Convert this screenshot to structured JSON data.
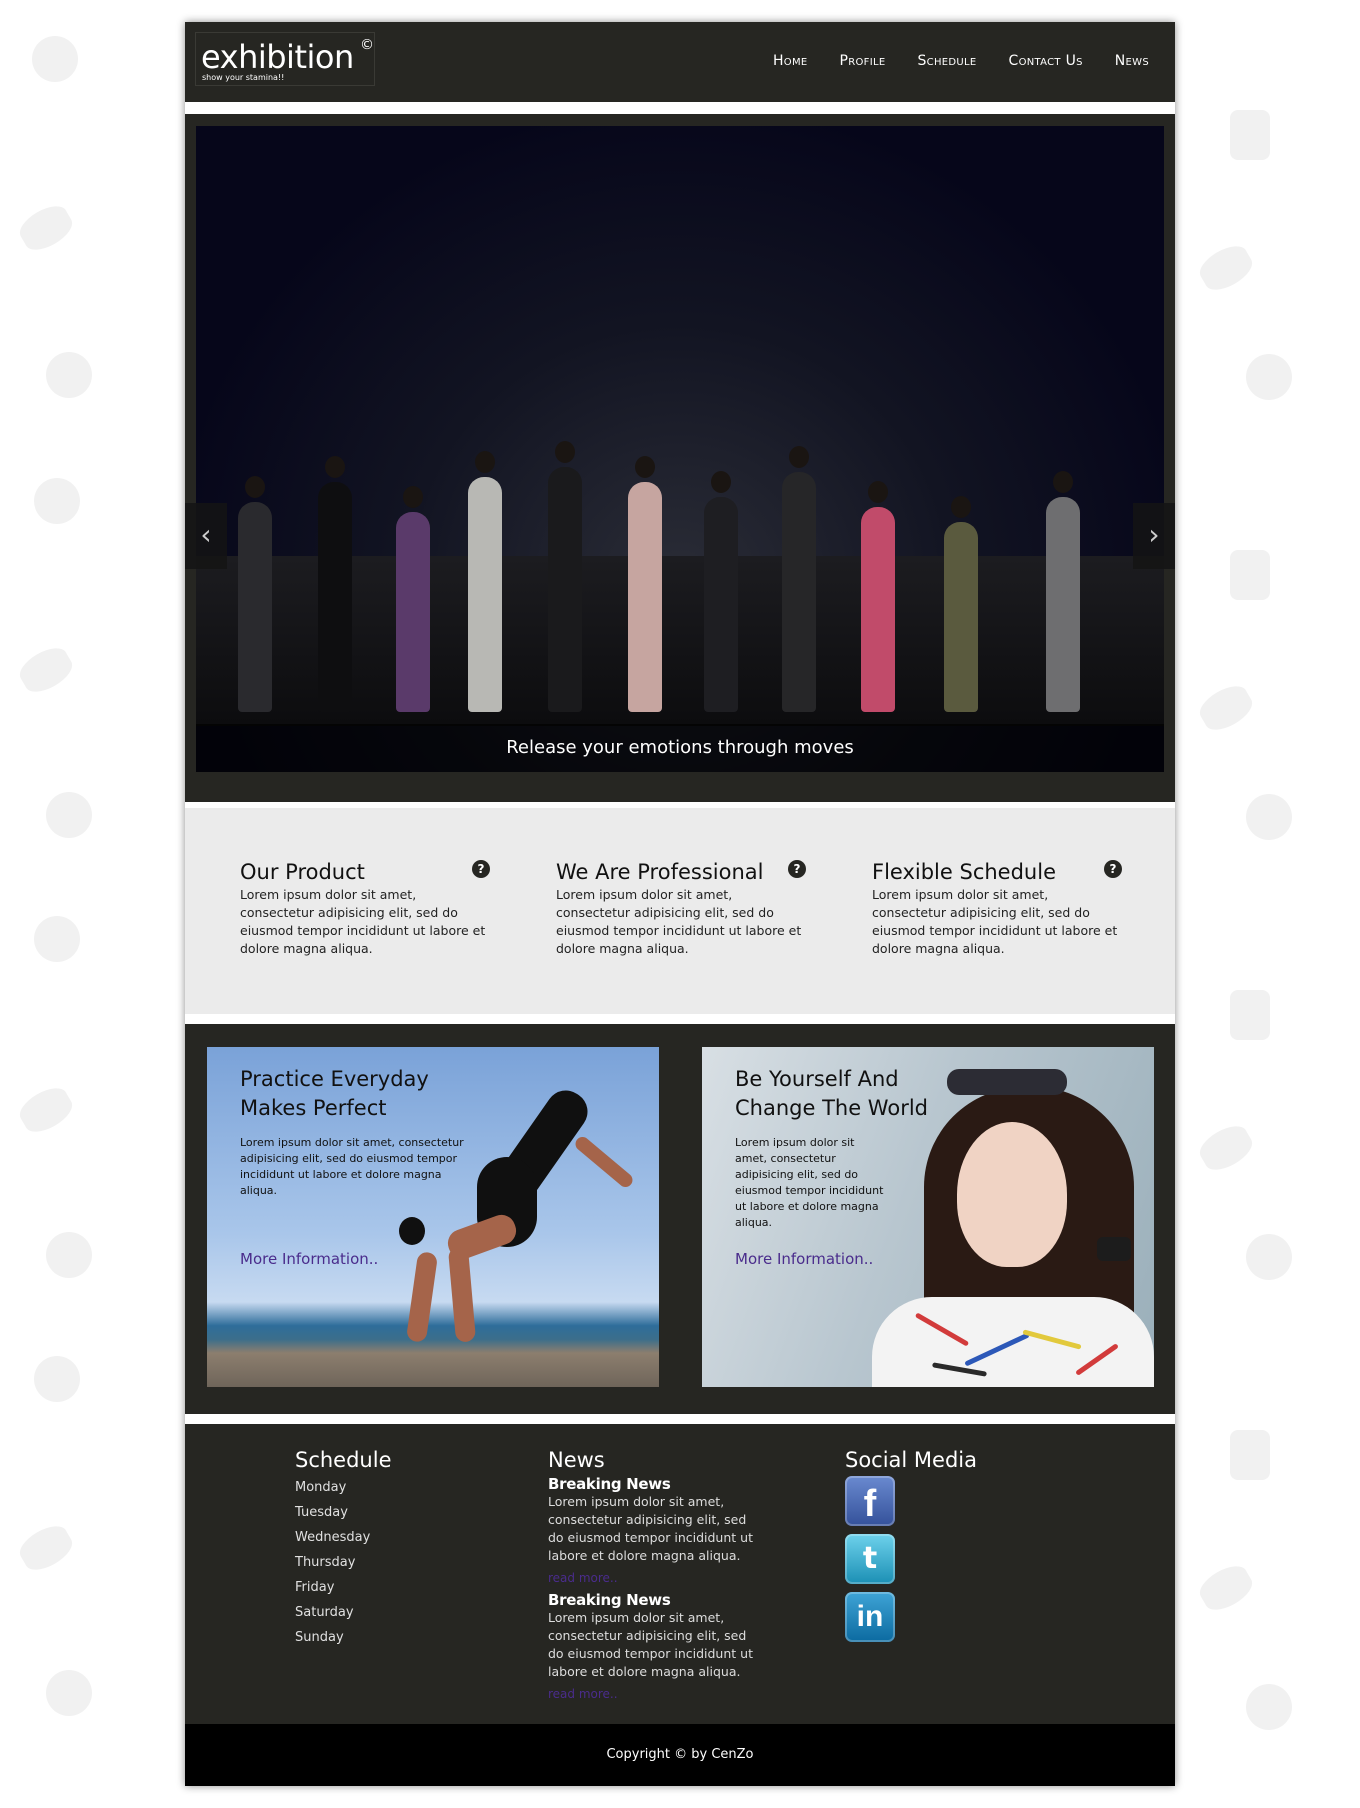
{
  "brand": {
    "name": "exhibition",
    "copyright_mark": "©",
    "tagline": "show your stamina!!"
  },
  "nav": {
    "items": [
      "Home",
      "Profile",
      "Schedule",
      "Contact Us",
      "News"
    ]
  },
  "slider": {
    "caption": "Release your emotions through moves",
    "prev_icon": "chevron-left-icon",
    "next_icon": "chevron-right-icon"
  },
  "features": [
    {
      "title": "Our Product",
      "text": "Lorem ipsum dolor sit amet, consectetur adipisicing elit, sed do eiusmod tempor incididunt ut labore et dolore magna aliqua.",
      "icon": "question-circle-icon"
    },
    {
      "title": "We Are Professional",
      "text": "Lorem ipsum dolor sit amet, consectetur adipisicing elit, sed do eiusmod tempor incididunt ut labore et dolore magna aliqua.",
      "icon": "question-circle-icon"
    },
    {
      "title": "Flexible Schedule",
      "text": "Lorem ipsum dolor sit amet, consectetur adipisicing elit, sed do eiusmod tempor incididunt ut labore et dolore magna aliqua.",
      "icon": "question-circle-icon"
    }
  ],
  "promos": [
    {
      "title_line1": "Practice Everyday",
      "title_line2": "Makes Perfect",
      "text": "Lorem ipsum dolor sit amet, consectetur adipisicing elit, sed do eiusmod tempor incididunt ut labore et dolore magna aliqua.",
      "link": "More Information.."
    },
    {
      "title_line1": "Be Yourself And",
      "title_line2": "Change The World",
      "text": "Lorem ipsum dolor sit amet, consectetur adipisicing elit, sed do eiusmod tempor incididunt ut labore et dolore magna aliqua.",
      "link": "More Information.."
    }
  ],
  "footer": {
    "schedule": {
      "heading": "Schedule",
      "days": [
        "Monday",
        "Tuesday",
        "Wednesday",
        "Thursday",
        "Friday",
        "Saturday",
        "Sunday"
      ]
    },
    "news": {
      "heading": "News",
      "items": [
        {
          "title": "Breaking News",
          "text": "Lorem ipsum dolor sit amet, consectetur adipisicing elit, sed do eiusmod tempor incididunt ut labore et dolore magna aliqua.",
          "link": "read more.."
        },
        {
          "title": "Breaking News",
          "text": "Lorem ipsum dolor sit amet, consectetur adipisicing elit, sed do eiusmod tempor incididunt ut labore et dolore magna aliqua.",
          "link": "read more.."
        }
      ]
    },
    "social": {
      "heading": "Social Media",
      "facebook_glyph": "f",
      "twitter_glyph": "t",
      "linkedin_glyph": "in"
    }
  },
  "copyright": "Copyright © by CenZo",
  "colors": {
    "header_bg": "#262622",
    "feature_bg": "#ebebeb",
    "link": "#4a2c8c",
    "copyright_bg": "#000000"
  }
}
